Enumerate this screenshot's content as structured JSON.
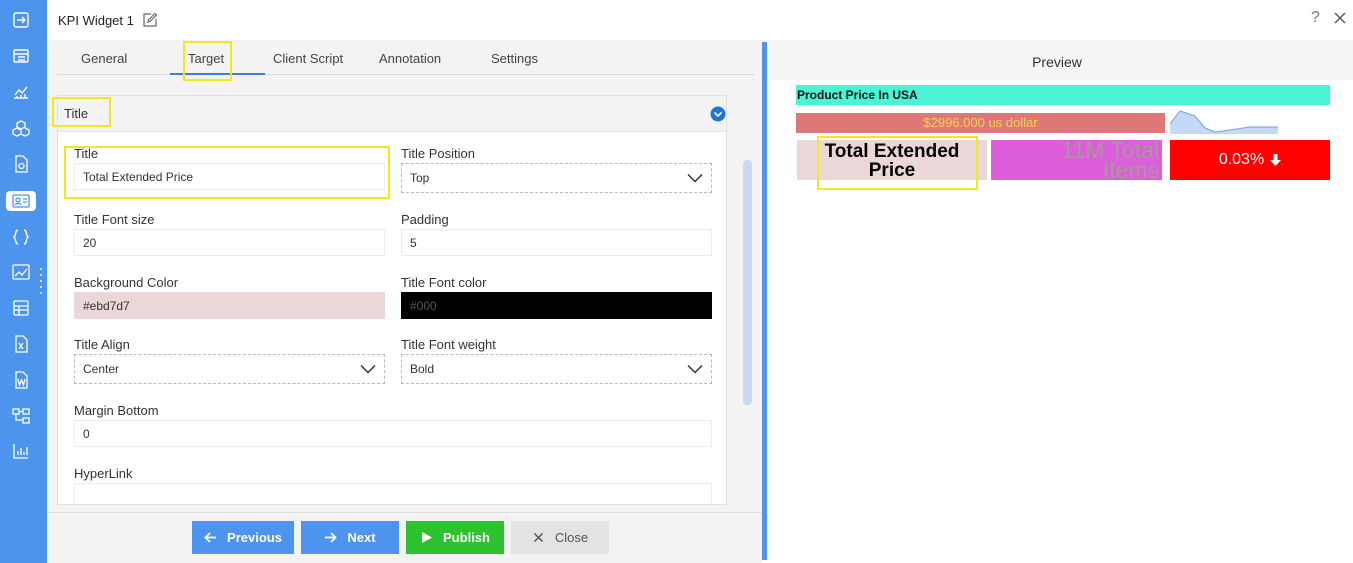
{
  "window": {
    "title": "KPI Widget 1"
  },
  "header": {
    "help_label": "?"
  },
  "tabs": [
    {
      "label": "General"
    },
    {
      "label": "Target"
    },
    {
      "label": "Client Script"
    },
    {
      "label": "Annotation"
    },
    {
      "label": "Settings"
    }
  ],
  "active_tab": "Target",
  "section": {
    "title": "Title"
  },
  "fields": {
    "title": {
      "label": "Title",
      "value": "Total Extended Price"
    },
    "title_position": {
      "label": "Title Position",
      "value": "Top"
    },
    "title_font_size": {
      "label": "Title Font size",
      "value": "20"
    },
    "padding": {
      "label": "Padding",
      "value": "5"
    },
    "background_color": {
      "label": "Background Color",
      "value": "#ebd7d7"
    },
    "title_font_color": {
      "label": "Title Font color",
      "value": "#000"
    },
    "title_align": {
      "label": "Title Align",
      "value": "Center"
    },
    "title_font_weight": {
      "label": "Title Font weight",
      "value": "Bold"
    },
    "margin_bottom": {
      "label": "Margin Bottom",
      "value": "0"
    },
    "hyperlink": {
      "label": "HyperLink",
      "value": ""
    }
  },
  "buttons": {
    "previous": "Previous",
    "next": "Next",
    "publish": "Publish",
    "close": "Close"
  },
  "preview": {
    "heading": "Preview",
    "kpi_title": "Product Price In USA",
    "kpi_value": "$2996.000 us dollar",
    "target_title_line1": "Total Extended",
    "target_title_line2": "Price",
    "count_line1": "11M Total",
    "count_line2": "Items",
    "change": "0.03%"
  },
  "colors": {
    "accent": "#4d94ee",
    "publish": "#2fc22f",
    "kpi_title_bg": "#4af2d6",
    "kpi_value_bg": "#dc7878",
    "kpi_value_text": "#f6d24c",
    "target_bg": "#ebd7d7",
    "count_bg": "#de5ddb",
    "change_bg": "#ff0000",
    "highlight": "#f2e81d"
  },
  "rail_icons": [
    "login-icon",
    "list-icon",
    "line-chart-icon",
    "cubes-icon",
    "file-gear-icon",
    "id-card-icon",
    "braces-icon",
    "image-chart-icon",
    "grid-table-icon",
    "excel-file-icon",
    "word-file-icon",
    "hierarchy-icon",
    "bar-chart-icon"
  ]
}
